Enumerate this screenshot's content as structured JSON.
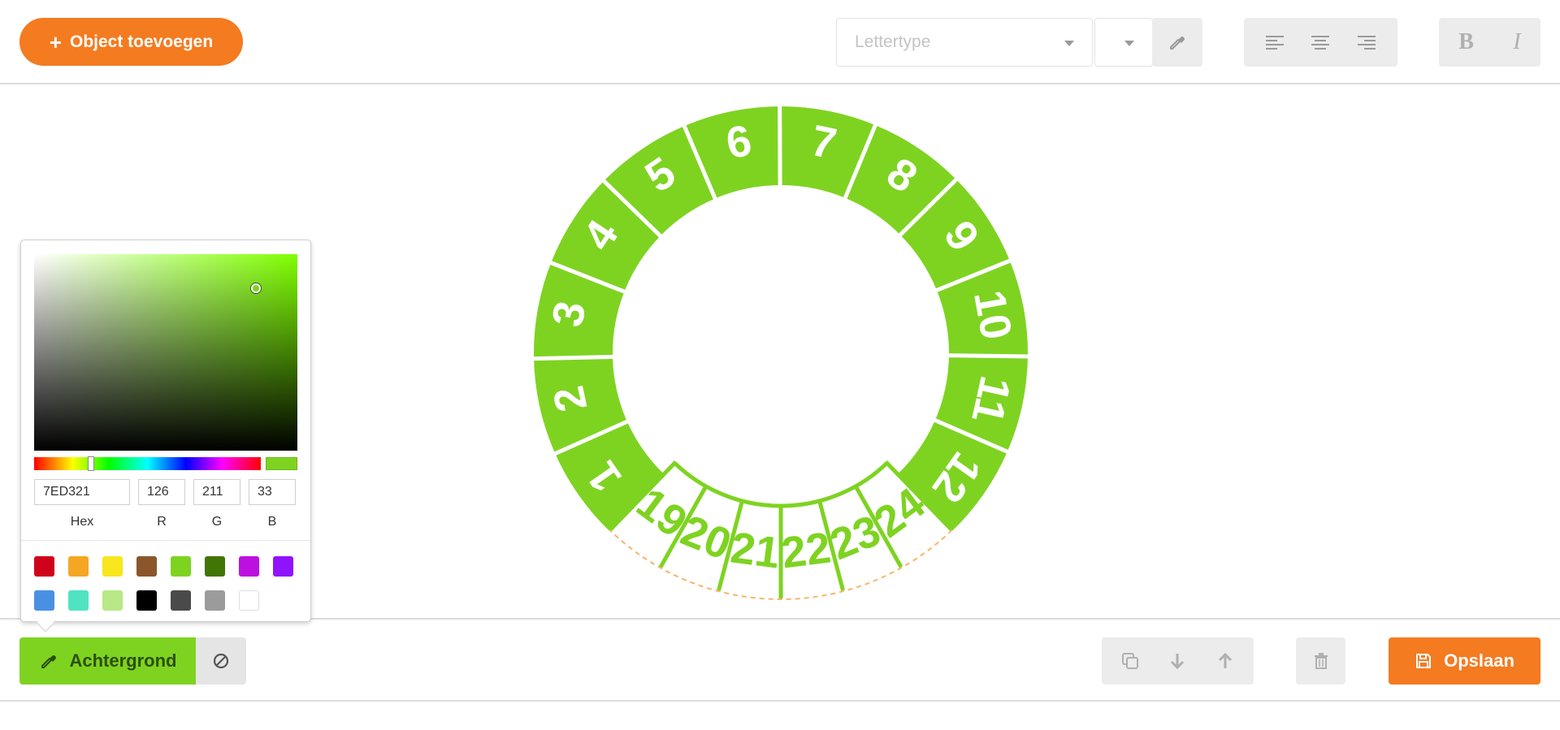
{
  "toolbar": {
    "add_object_label": "Object toevoegen",
    "font_placeholder": "Lettertype",
    "font_size_value": ""
  },
  "sticker": {
    "color": "#7ed321",
    "outer_numbers": [
      "1",
      "2",
      "3",
      "4",
      "5",
      "6",
      "7",
      "8",
      "9",
      "10",
      "11",
      "12"
    ],
    "inner_years": [
      "19",
      "20",
      "21",
      "22",
      "23",
      "24"
    ]
  },
  "color_picker": {
    "hex_value": "7ED321",
    "r_value": "126",
    "g_value": "211",
    "b_value": "33",
    "hex_label": "Hex",
    "r_label": "R",
    "g_label": "G",
    "b_label": "B",
    "swatches": [
      "#d0021b",
      "#f5a623",
      "#f8e71c",
      "#8b572a",
      "#7ed321",
      "#417505",
      "#bd10e0",
      "#9013fe",
      "#4a90e2",
      "#50e3c2",
      "#b8e986",
      "#000000",
      "#4a4a4a",
      "#9b9b9b",
      "#ffffff"
    ]
  },
  "bottombar": {
    "background_label": "Achtergrond",
    "save_label": "Opslaan"
  }
}
